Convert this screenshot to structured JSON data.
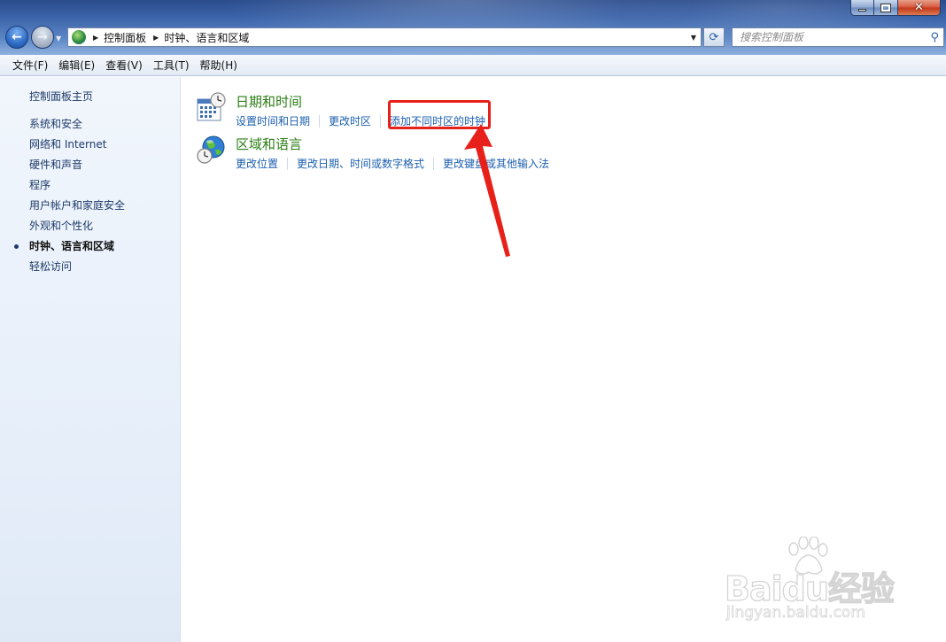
{
  "window": {
    "caption_buttons": {
      "minimize_icon": "minimize-icon",
      "maximize_icon": "maximize-icon",
      "close_icon": "close-icon"
    }
  },
  "address_bar": {
    "breadcrumbs": [
      "控制面板",
      "时钟、语言和区域"
    ]
  },
  "search": {
    "placeholder": "搜索控制面板"
  },
  "menu": [
    "文件(F)",
    "编辑(E)",
    "查看(V)",
    "工具(T)",
    "帮助(H)"
  ],
  "sidebar": {
    "home": "控制面板主页",
    "items": [
      {
        "label": "系统和安全"
      },
      {
        "label": "网络和 Internet"
      },
      {
        "label": "硬件和声音"
      },
      {
        "label": "程序"
      },
      {
        "label": "用户帐户和家庭安全"
      },
      {
        "label": "外观和个性化"
      },
      {
        "label": "时钟、语言和区域",
        "current": true
      },
      {
        "label": "轻松访问"
      }
    ]
  },
  "main": {
    "categories": [
      {
        "title": "日期和时间",
        "icon": "calendar-clock-icon",
        "links": [
          "设置时间和日期",
          "更改时区",
          "添加不同时区的时钟"
        ]
      },
      {
        "title": "区域和语言",
        "icon": "globe-clock-icon",
        "links": [
          "更改位置",
          "更改日期、时间或数字格式",
          "更改键盘或其他输入法"
        ]
      }
    ]
  },
  "annotation": {
    "highlight_color": "#e8201a"
  },
  "watermark": {
    "brand": "Baidu",
    "suffix": "经验",
    "domain": "jingyan.baidu.com"
  }
}
